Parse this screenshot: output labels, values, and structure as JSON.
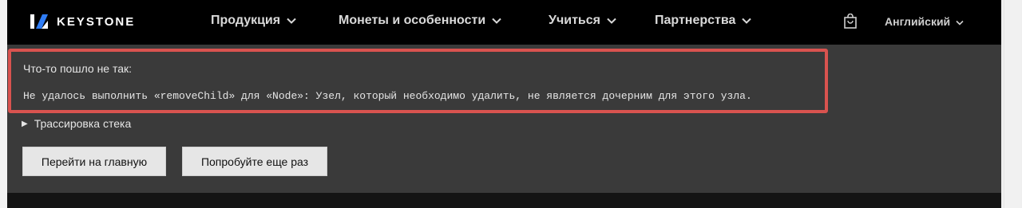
{
  "brand": {
    "name": "KEYSTONE"
  },
  "nav": {
    "items": [
      {
        "label": "Продукция"
      },
      {
        "label": "Монеты и особенности"
      },
      {
        "label": "Учиться"
      },
      {
        "label": "Партнерства"
      }
    ],
    "language": "Английский"
  },
  "error": {
    "title": "Что-то пошло не так:",
    "message": "Не удалось выполнить «removeChild» для «Node»: Узел, который необходимо удалить, не является дочерним для этого узла.",
    "stack_label": "Трассировка стека",
    "highlight_color": "#d9534f"
  },
  "actions": {
    "home_label": "Перейти на главную",
    "retry_label": "Попробуйте еще раз"
  },
  "icons": {
    "logo": "keystone-logo-icon",
    "chevron": "chevron-down-icon",
    "bag": "shopping-bag-icon",
    "disclosure": "disclosure-triangle-icon"
  }
}
